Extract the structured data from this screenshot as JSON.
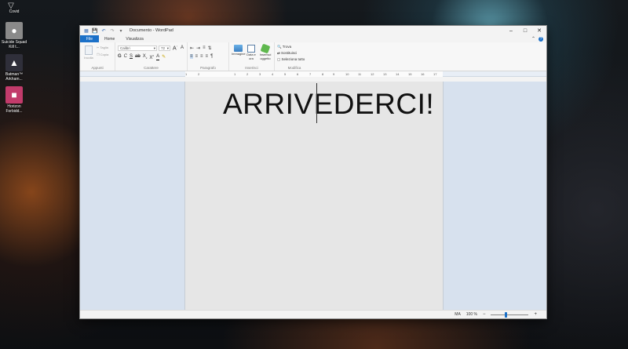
{
  "desktop": {
    "icons": [
      {
        "name": "Covid",
        "label": "Covid",
        "color": "#4a4a4a"
      },
      {
        "name": "suicide-squad",
        "label": "Suicide Squad Kill t...",
        "color": "#7a7a7a"
      },
      {
        "name": "batman",
        "label": "Batman™ Arkham...",
        "color": "#2f2f3a"
      },
      {
        "name": "horizon",
        "label": "Horizon Forbidd...",
        "color": "#c23b6b"
      }
    ]
  },
  "window": {
    "title": "Documento - WordPad",
    "controls": {
      "minimize": "–",
      "maximize": "□",
      "close": "✕"
    },
    "tabs": [
      {
        "label": "File"
      },
      {
        "label": "Home"
      },
      {
        "label": "Visualizza"
      }
    ],
    "ribbon": {
      "clipboard": {
        "label": "Appunti",
        "paste": "Incolla",
        "cut": "Taglia",
        "copy": "Copia"
      },
      "font": {
        "label": "Carattere",
        "font_name": "Calibri",
        "font_size": "72"
      },
      "paragraph": {
        "label": "Paragrafo"
      },
      "insert": {
        "label": "Inserisci",
        "picture": "Immagine",
        "datetime": "Data e ora",
        "object": "Inserisci oggetto"
      },
      "editing": {
        "label": "Modifica",
        "find": "Trova",
        "replace": "Sostituisci",
        "select_all": "Seleziona tutto"
      }
    },
    "ruler_numbers": [
      "1",
      "2",
      "1",
      "2",
      "3",
      "4",
      "5",
      "6",
      "7",
      "8",
      "9",
      "10",
      "11",
      "12",
      "13",
      "14",
      "15",
      "16",
      "17"
    ],
    "document": {
      "text": "ARRIVEDERCI!"
    },
    "statusbar": {
      "caps": "MA",
      "zoom": "100 %",
      "zoom_minus": "−",
      "zoom_plus": "+"
    }
  },
  "colors": {
    "accent": "#1a70c8",
    "page": "#e6e6e6",
    "workspace": "#d7e1ee"
  }
}
